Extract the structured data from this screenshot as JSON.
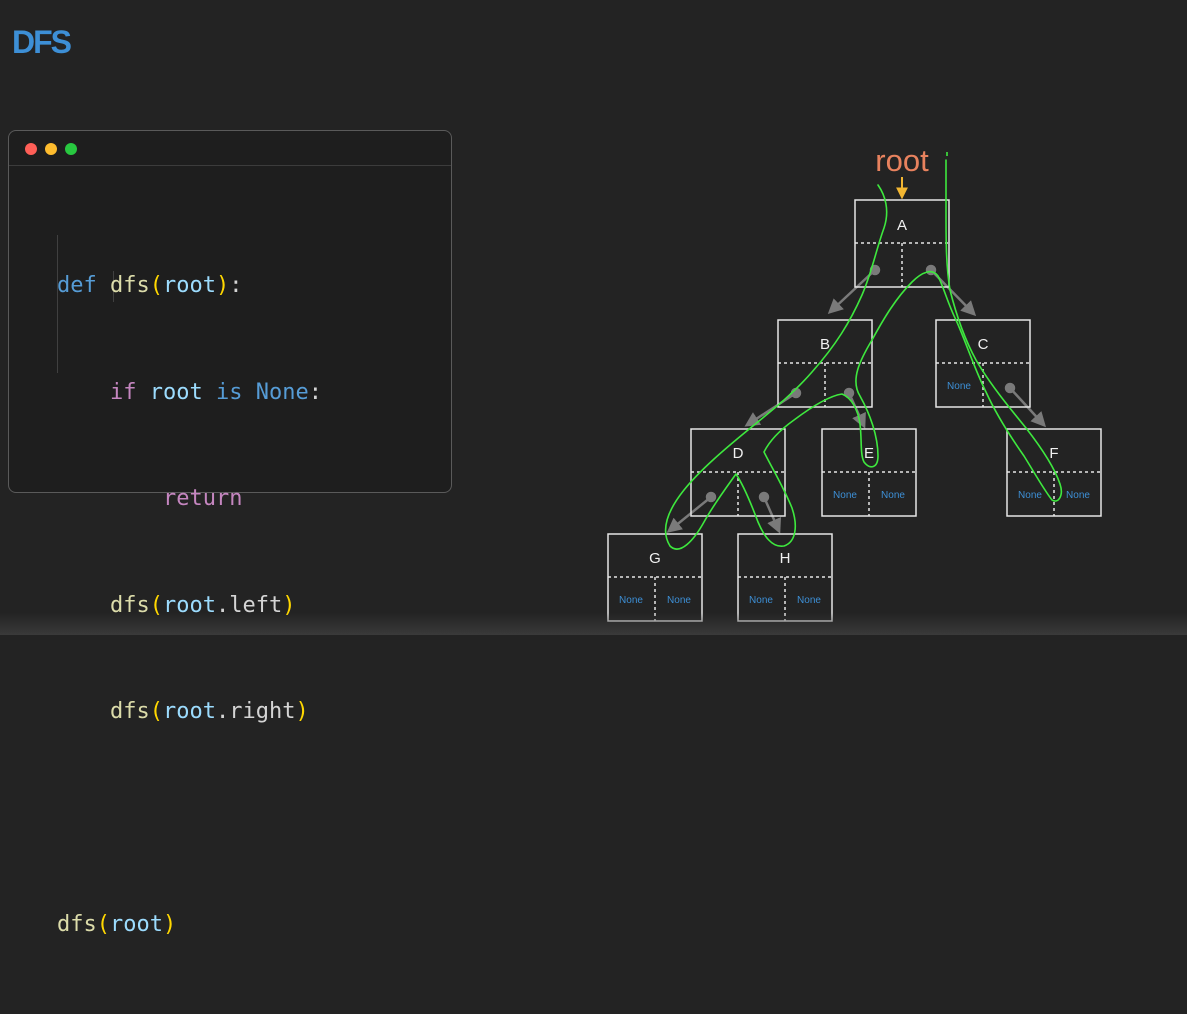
{
  "slide": {
    "title": "DFS"
  },
  "code": {
    "line1": {
      "def": "def",
      "fn": "dfs",
      "open": "(",
      "arg": "root",
      "close": ")",
      "colon": ":"
    },
    "line2": {
      "if": "if",
      "root": "root",
      "is": "is",
      "none": "None",
      "colon": ":"
    },
    "line3": {
      "return": "return"
    },
    "line4": {
      "fn": "dfs",
      "open": "(",
      "root": "root",
      "attr": ".left",
      "close": ")"
    },
    "line5": {
      "fn": "dfs",
      "open": "(",
      "root": "root",
      "attr": ".right",
      "close": ")"
    },
    "line6": {
      "fn": "dfs",
      "open": "(",
      "arg": "root",
      "close": ")"
    }
  },
  "tree": {
    "root_label": "root",
    "nodes": {
      "A": {
        "label": "A",
        "left": "",
        "right": ""
      },
      "B": {
        "label": "B",
        "left": "",
        "right": ""
      },
      "C": {
        "label": "C",
        "left": "None",
        "right": ""
      },
      "D": {
        "label": "D",
        "left": "",
        "right": ""
      },
      "E": {
        "label": "E",
        "left": "None",
        "right": "None"
      },
      "F": {
        "label": "F",
        "left": "None",
        "right": "None"
      },
      "G": {
        "label": "G",
        "left": "None",
        "right": "None"
      },
      "H": {
        "label": "H",
        "left": "None",
        "right": "None"
      }
    },
    "colors": {
      "root_label": "#e8825e",
      "root_arrow": "#f2b632",
      "none_text": "#3d8fd6",
      "trace": "#3ee83e",
      "pointer": "#7a7a7a"
    }
  }
}
